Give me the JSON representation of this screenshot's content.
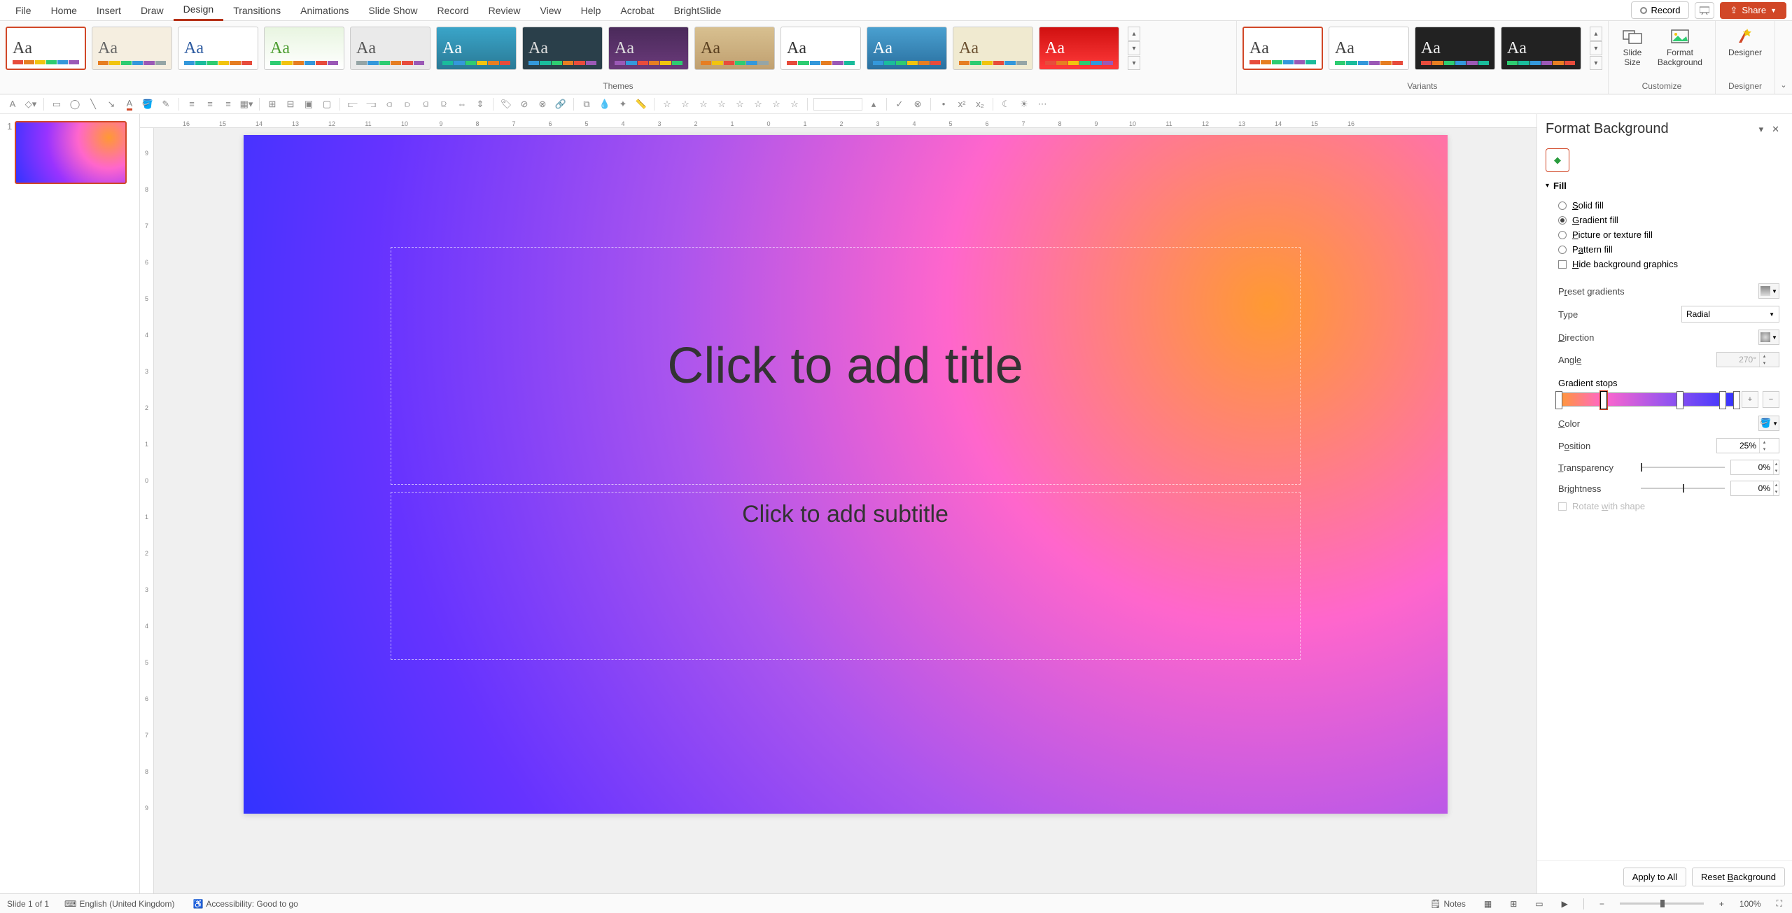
{
  "menu": {
    "tabs": [
      "File",
      "Home",
      "Insert",
      "Draw",
      "Design",
      "Transitions",
      "Animations",
      "Slide Show",
      "Record",
      "Review",
      "View",
      "Help",
      "Acrobat",
      "BrightSlide"
    ],
    "active": "Design",
    "record": "Record",
    "share": "Share"
  },
  "ribbon": {
    "themes_label": "Themes",
    "variants_label": "Variants",
    "customize_label": "Customize",
    "designer_label": "Designer",
    "slide_size": "Slide\nSize",
    "format_bg": "Format\nBackground",
    "designer": "Designer"
  },
  "slide": {
    "title_placeholder": "Click to add title",
    "subtitle_placeholder": "Click to add subtitle",
    "number": "1"
  },
  "ruler_h": [
    "16",
    "15",
    "14",
    "13",
    "12",
    "11",
    "10",
    "9",
    "8",
    "7",
    "6",
    "5",
    "4",
    "3",
    "2",
    "1",
    "0",
    "1",
    "2",
    "3",
    "4",
    "5",
    "6",
    "7",
    "8",
    "9",
    "10",
    "11",
    "12",
    "13",
    "14",
    "15",
    "16"
  ],
  "ruler_v": [
    "9",
    "8",
    "7",
    "6",
    "5",
    "4",
    "3",
    "2",
    "1",
    "0",
    "1",
    "2",
    "3",
    "4",
    "5",
    "6",
    "7",
    "8",
    "9"
  ],
  "pane": {
    "title": "Format Background",
    "fill_section": "Fill",
    "solid": "Solid fill",
    "gradient": "Gradient fill",
    "picture": "Picture or texture fill",
    "pattern": "Pattern fill",
    "hide_bg": "Hide background graphics",
    "preset": "Preset gradients",
    "type": "Type",
    "type_value": "Radial",
    "direction": "Direction",
    "angle": "Angle",
    "angle_value": "270°",
    "stops": "Gradient stops",
    "color": "Color",
    "position": "Position",
    "position_value": "25%",
    "transparency": "Transparency",
    "transparency_value": "0%",
    "brightness": "Brightness",
    "brightness_value": "0%",
    "rotate": "Rotate with shape",
    "apply_all": "Apply to All",
    "reset": "Reset Background"
  },
  "status": {
    "slide": "Slide 1 of 1",
    "lang": "English (United Kingdom)",
    "access": "Accessibility: Good to go",
    "notes": "Notes",
    "zoom": "100%"
  }
}
